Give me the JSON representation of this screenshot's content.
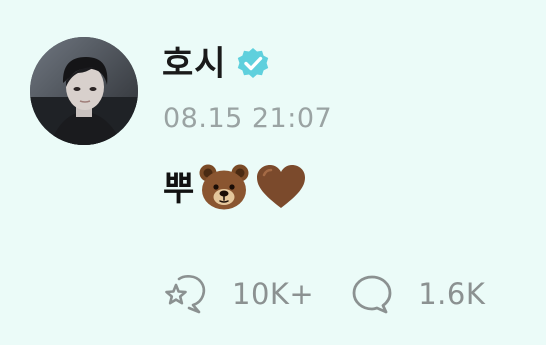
{
  "post": {
    "author": {
      "name": "호시",
      "verified": true,
      "avatar_alt": "profile photo"
    },
    "timestamp": "08.15 21:07",
    "text": "뿌",
    "emojis": [
      "bear-face",
      "brown-heart"
    ],
    "actions": [
      {
        "name": "like",
        "icon": "sparkle-bubble-icon",
        "count": "10K+"
      },
      {
        "name": "comment",
        "icon": "speech-bubble-icon",
        "count": "1.6K"
      }
    ]
  },
  "colors": {
    "background": "#ebfbf8",
    "verified": "#5fd0dd",
    "muted_text": "#9aa3a3",
    "icon_gray": "#8b9191"
  }
}
